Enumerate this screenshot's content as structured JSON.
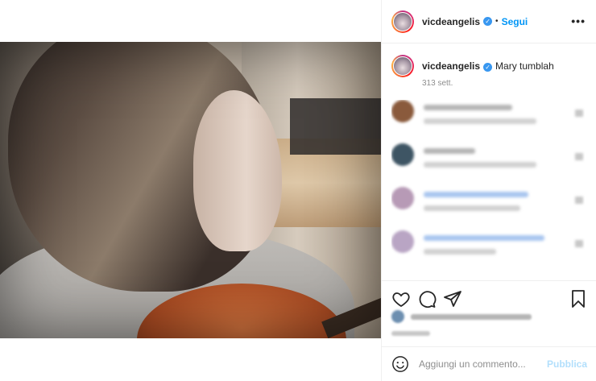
{
  "header": {
    "username": "vicdeangelis",
    "separator": "•",
    "follow_label": "Segui",
    "more_label": "•••"
  },
  "caption": {
    "username": "vicdeangelis",
    "text": "Mary tumblah",
    "time_ago": "313 sett."
  },
  "comment_box": {
    "placeholder": "Aggiungi un commento...",
    "publish_label": "Pubblica"
  },
  "icons": {
    "verified": "verified-badge-icon",
    "like": "heart-icon",
    "comment": "comment-icon",
    "share": "paper-plane-icon",
    "save": "bookmark-icon",
    "emoji": "emoji-icon",
    "more": "more-options-icon"
  },
  "colors": {
    "accent": "#0095f6",
    "verified": "#3897f0",
    "publish_disabled": "#b2dffc",
    "muted": "#8e8e8e"
  }
}
